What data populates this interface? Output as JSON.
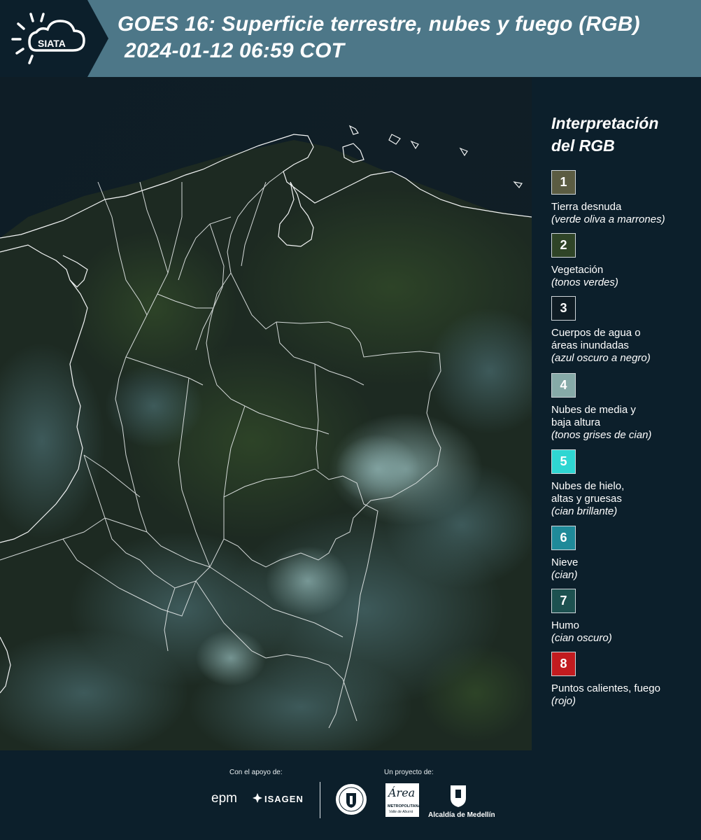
{
  "header": {
    "logo_text": "SIATA",
    "title_line1": "GOES 16: Superficie terrestre, nubes y fuego (RGB)",
    "title_line2": "2024-01-12 06:59 COT"
  },
  "legend": {
    "title_line1": "Interpretación",
    "title_line2": "del RGB",
    "items": [
      {
        "num": "1",
        "color": "#5b5c42",
        "lines": [
          "Tierra desnuda"
        ],
        "note": "(verde oliva a marrones)"
      },
      {
        "num": "2",
        "color": "#2f4427",
        "lines": [
          "Vegetación"
        ],
        "note": "(tonos verdes)"
      },
      {
        "num": "3",
        "color": "#0f1c24",
        "lines": [
          "Cuerpos de agua o",
          "áreas inundadas"
        ],
        "note": "(azul oscuro a negro)"
      },
      {
        "num": "4",
        "color": "#86aaa8",
        "lines": [
          "Nubes de media y",
          "baja altura"
        ],
        "note": "(tonos grises de cian)"
      },
      {
        "num": "5",
        "color": "#2fd6d2",
        "lines": [
          "Nubes de hielo,",
          "altas y gruesas"
        ],
        "note": "(cian brillante)"
      },
      {
        "num": "6",
        "color": "#1f8a99",
        "lines": [
          "Nieve"
        ],
        "note": "(cian)"
      },
      {
        "num": "7",
        "color": "#1d5150",
        "lines": [
          "Humo"
        ],
        "note": "(cian oscuro)"
      },
      {
        "num": "8",
        "color": "#c21b1f",
        "lines": [
          "Puntos calientes, fuego"
        ],
        "note": "(rojo)"
      }
    ]
  },
  "footer": {
    "support_label": "Con el apoyo de:",
    "project_label": "Un proyecto de:",
    "epm": "epm",
    "isagen": "ISAGEN",
    "area_metro": "Área",
    "area_metro_sub": "METROPOLITANA",
    "area_metro_sub2": "Valle de Aburrá",
    "alcaldia": "Alcaldía de Medellín"
  }
}
